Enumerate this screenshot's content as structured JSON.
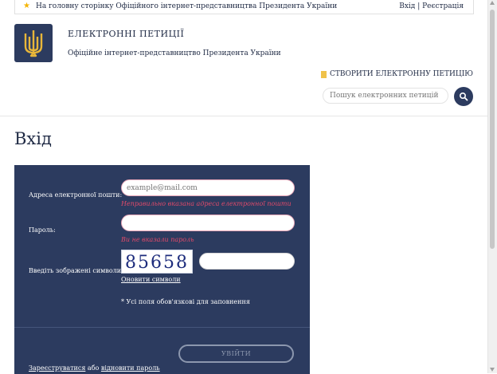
{
  "topbar": {
    "home_link": "На головну сторінку Офіційного інтернет-представництва Президента України",
    "auth_links": "Вхід | Реєстрація"
  },
  "header": {
    "title": "ЕЛЕКТРОННІ ПЕТИЦІЇ",
    "subtitle": "Офіційне інтернет-представництво Президента України",
    "create_petition": "СТВОРИТИ ЕЛЕКТРОННУ ПЕТИЦІЮ"
  },
  "search": {
    "placeholder": "Пошук електронних петицій",
    "icon": "search-icon"
  },
  "page": {
    "title": "Вхід"
  },
  "form": {
    "email_label": "Адреса електронної пошти:",
    "email_placeholder": "example@mail.com",
    "email_error": "Неправильно вказана адреса електронної пошти",
    "password_label": "Пароль:",
    "password_error": "Ви не вказали пароль",
    "captcha_label": "Введіть зображені символи:",
    "captcha_text": "85658",
    "refresh_label": "Оновити символи",
    "required_note": "* Усі поля обов'язкові для заповнення",
    "submit_label": "УВІЙТИ",
    "register_link": "Зареєструватися",
    "or_text": " або ",
    "restore_link": "відновити пароль"
  },
  "colors": {
    "primary": "#2c3b5f",
    "error": "#e04a6a",
    "accent": "#f4b400"
  }
}
